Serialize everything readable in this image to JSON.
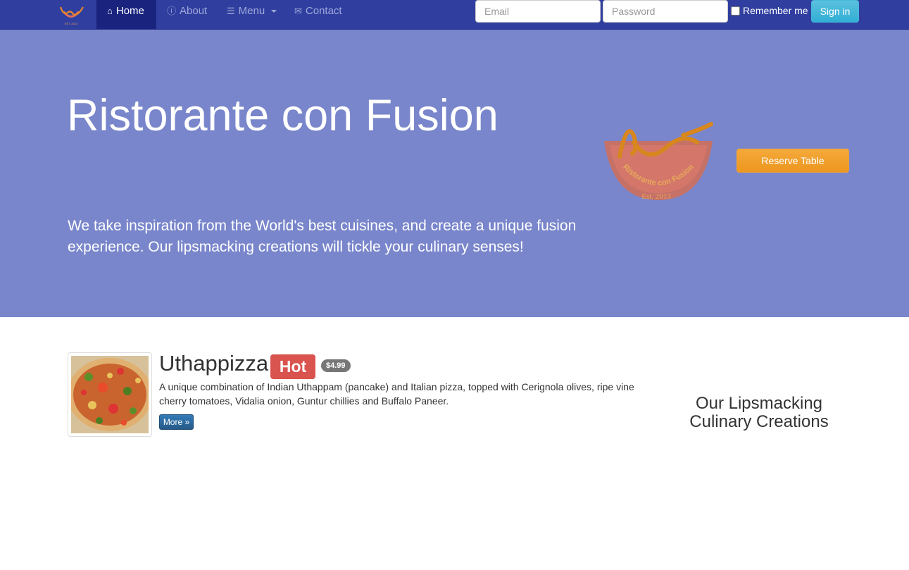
{
  "navbar": {
    "brand_alt": "Ristorante con Fusion",
    "home_label": "Home",
    "about_label": "About",
    "menu_label": "Menu",
    "contact_label": "Contact",
    "email_placeholder": "Email",
    "password_placeholder": "Password",
    "remember_label": "Remember me",
    "signin_label": "Sign in"
  },
  "jumbotron": {
    "title": "Ristorante con Fusion",
    "description": "We take inspiration from the World's best cuisines, and create a unique fusion experience. Our lipsmacking creations will tickle your culinary senses!",
    "logo_text": "Ristorante con Fusion",
    "logo_est": "Est. 2013",
    "reserve_label": "Reserve Table"
  },
  "featured": {
    "name": "Uthappizza",
    "badge": "Hot",
    "price": "$4.99",
    "description": "A unique combination of Indian Uthappam (pancake) and Italian pizza, topped with Cerignola olives, ripe vine cherry tomatoes, Vidalia onion, Guntur chillies and Buffalo Paneer.",
    "more_label": "More »"
  },
  "sidebar": {
    "title": "Our Lipsmacking Culinary Creations"
  },
  "colors": {
    "navbar": "#303F9F",
    "jumbotron": "#7986CB",
    "hot_badge": "#d9534f",
    "reserve_button": "#f0ad4e",
    "signin_button": "#5bc0de"
  }
}
